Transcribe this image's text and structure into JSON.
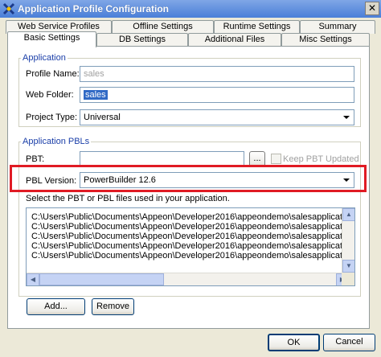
{
  "window": {
    "title": "Application Profile Configuration",
    "close_glyph": "✕"
  },
  "tabs_back": [
    "Web Service Profiles",
    "Offline Settings",
    "Runtime Settings",
    "Summary"
  ],
  "tabs_front": [
    "Basic Settings",
    "DB Settings",
    "Additional Files",
    "Misc Settings"
  ],
  "application": {
    "group_label": "Application",
    "profile_name_label": "Profile Name:",
    "profile_name_value": "sales",
    "web_folder_label": "Web Folder:",
    "web_folder_value": "sales",
    "project_type_label": "Project Type:",
    "project_type_value": "Universal"
  },
  "pbls": {
    "group_label": "Application PBLs",
    "pbt_label": "PBT:",
    "pbt_value": "",
    "browse_label": "...",
    "keep_pbt_label": "Keep PBT Updated",
    "pbl_version_label": "PBL Version:",
    "pbl_version_value": "PowerBuilder 12.6",
    "instruction": "Select the PBT or PBL files used in your application.",
    "files": [
      "C:\\Users\\Public\\Documents\\Appeon\\Developer2016\\appeondemo\\salesapplicationdemo\\sales_",
      "C:\\Users\\Public\\Documents\\Appeon\\Developer2016\\appeondemo\\salesapplicationdemo\\sales_",
      "C:\\Users\\Public\\Documents\\Appeon\\Developer2016\\appeondemo\\salesapplicationdemo\\appec",
      "C:\\Users\\Public\\Documents\\Appeon\\Developer2016\\appeondemo\\salesapplicationdemo\\appec",
      "C:\\Users\\Public\\Documents\\Appeon\\Developer2016\\appeondemo\\salesapplicationdemo\\appec"
    ],
    "add_label": "Add...",
    "remove_label": "Remove"
  },
  "footer": {
    "ok_label": "OK",
    "cancel_label": "Cancel"
  },
  "colors": {
    "highlight": "#e01b24",
    "title_bar": "#4a7fd8",
    "selection": "#316ac5"
  }
}
